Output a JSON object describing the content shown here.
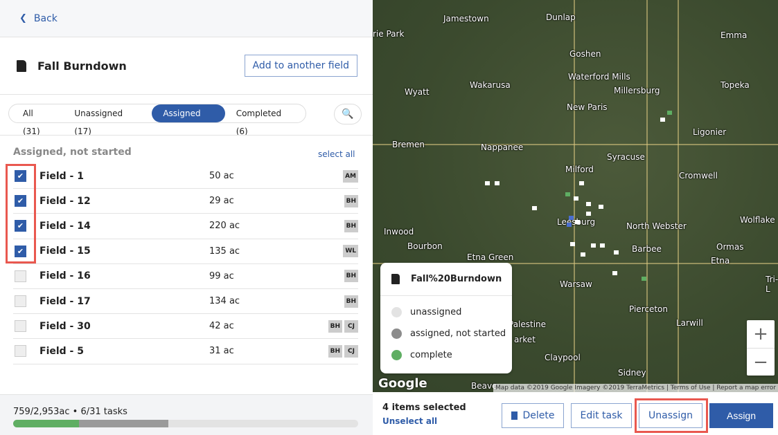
{
  "back_label": "Back",
  "task": {
    "title": "Fall Burndown",
    "add_button": "Add to another field"
  },
  "tabs": [
    {
      "label": "All (31)"
    },
    {
      "label": "Unassigned (17)"
    },
    {
      "label": "Assigned (8)",
      "active": true
    },
    {
      "label": "Completed (6)"
    }
  ],
  "section": {
    "title": "Assigned, not started",
    "select_all": "select all"
  },
  "fields": [
    {
      "name": "Field - 1",
      "acres": "50 ac",
      "checked": true,
      "badges": [
        "AM"
      ]
    },
    {
      "name": "Field - 12",
      "acres": "29 ac",
      "checked": true,
      "badges": [
        "BH"
      ]
    },
    {
      "name": "Field - 14",
      "acres": "220 ac",
      "checked": true,
      "badges": [
        "BH"
      ]
    },
    {
      "name": "Field - 15",
      "acres": "135 ac",
      "checked": true,
      "badges": [
        "WL"
      ]
    },
    {
      "name": "Field - 16",
      "acres": "99 ac",
      "checked": false,
      "badges": [
        "BH"
      ]
    },
    {
      "name": "Field - 17",
      "acres": "134 ac",
      "checked": false,
      "badges": [
        "BH"
      ]
    },
    {
      "name": "Field - 30",
      "acres": "42 ac",
      "checked": false,
      "badges": [
        "BH",
        "CJ"
      ]
    },
    {
      "name": "Field - 5",
      "acres": "31 ac",
      "checked": false,
      "badges": [
        "BH",
        "CJ"
      ]
    }
  ],
  "progress": {
    "text": "759/2,953ac • 6/31 tasks",
    "complete_fraction": 0.19,
    "assigned_fraction": 0.26,
    "colors": {
      "complete": "#5fae63",
      "assigned": "#9a9a9a"
    }
  },
  "map": {
    "labels": [
      "Jamestown",
      "Dunlap",
      "Emma",
      "rie Park",
      "Goshen",
      "Wakarusa",
      "Waterford Mills",
      "Millersburg",
      "Topeka",
      "Wyatt",
      "New Paris",
      "Ligonier",
      "Bremen",
      "Nappanee",
      "Syracuse",
      "Milford",
      "Cromwell",
      "Inwood",
      "Leesburg",
      "North Webster",
      "Wolflake",
      "Bourbon",
      "Etna Green",
      "Barbee",
      "Ormas",
      "Etna",
      "Warsaw",
      "Pierceton",
      "Larwill",
      "Palestine",
      "arket",
      "Claypool",
      "Sidney",
      "Beave",
      "Tri-L"
    ],
    "legend": {
      "title": "Fall%20Burndown",
      "items": [
        {
          "label": "unassigned",
          "color": "#e3e3e3"
        },
        {
          "label": "assigned, not started",
          "color": "#8c8c8c"
        },
        {
          "label": "complete",
          "color": "#5fae63"
        }
      ]
    },
    "logo": "Google",
    "attribution": "Map data ©2019 Google Imagery ©2019 TerraMetrics | Terms of Use | Report a map error"
  },
  "actions": {
    "selected": "4 items selected",
    "unselect": "Unselect all",
    "delete": "Delete",
    "edit": "Edit task",
    "unassign": "Unassign",
    "assign": "Assign"
  }
}
